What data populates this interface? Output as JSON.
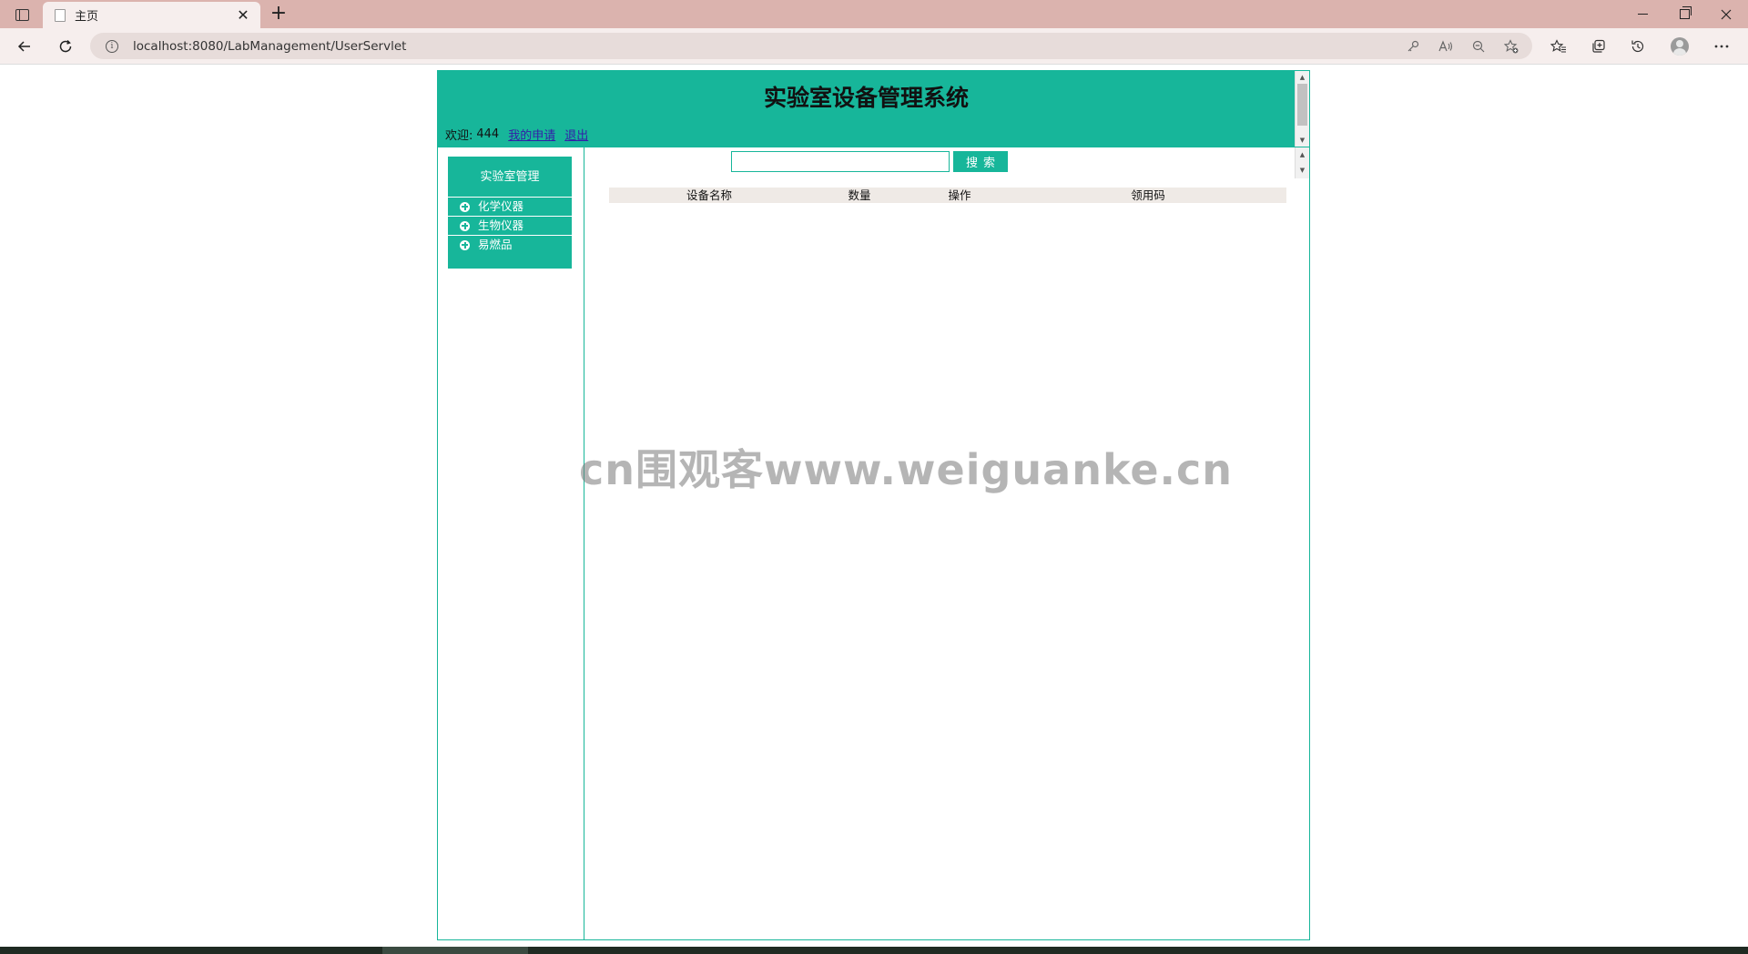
{
  "browser": {
    "tab_title": "主页",
    "url": "localhost:8080/LabManagement/UserServlet",
    "info_glyph": "i",
    "new_tab_glyph": "+",
    "close_glyph": "✕"
  },
  "header": {
    "title": "实验室设备管理系统",
    "welcome_label": "欢迎:",
    "username": "444",
    "my_applications_link": "我的申请",
    "logout_link": "退出"
  },
  "sidebar": {
    "menu_title": "实验室管理",
    "items": [
      {
        "label": "化学仪器"
      },
      {
        "label": "生物仪器"
      },
      {
        "label": "易燃品"
      }
    ]
  },
  "search": {
    "value": "",
    "placeholder": "",
    "button_label": "搜索"
  },
  "table": {
    "columns": [
      "设备名称",
      "数量",
      "操作",
      "领用码"
    ],
    "rows": []
  },
  "watermark": "cn围观客www.weiguanke.cn",
  "colors": {
    "accent": "#17b69a",
    "tabbar": "#dbb3ae",
    "table_header": "#efeae6"
  }
}
